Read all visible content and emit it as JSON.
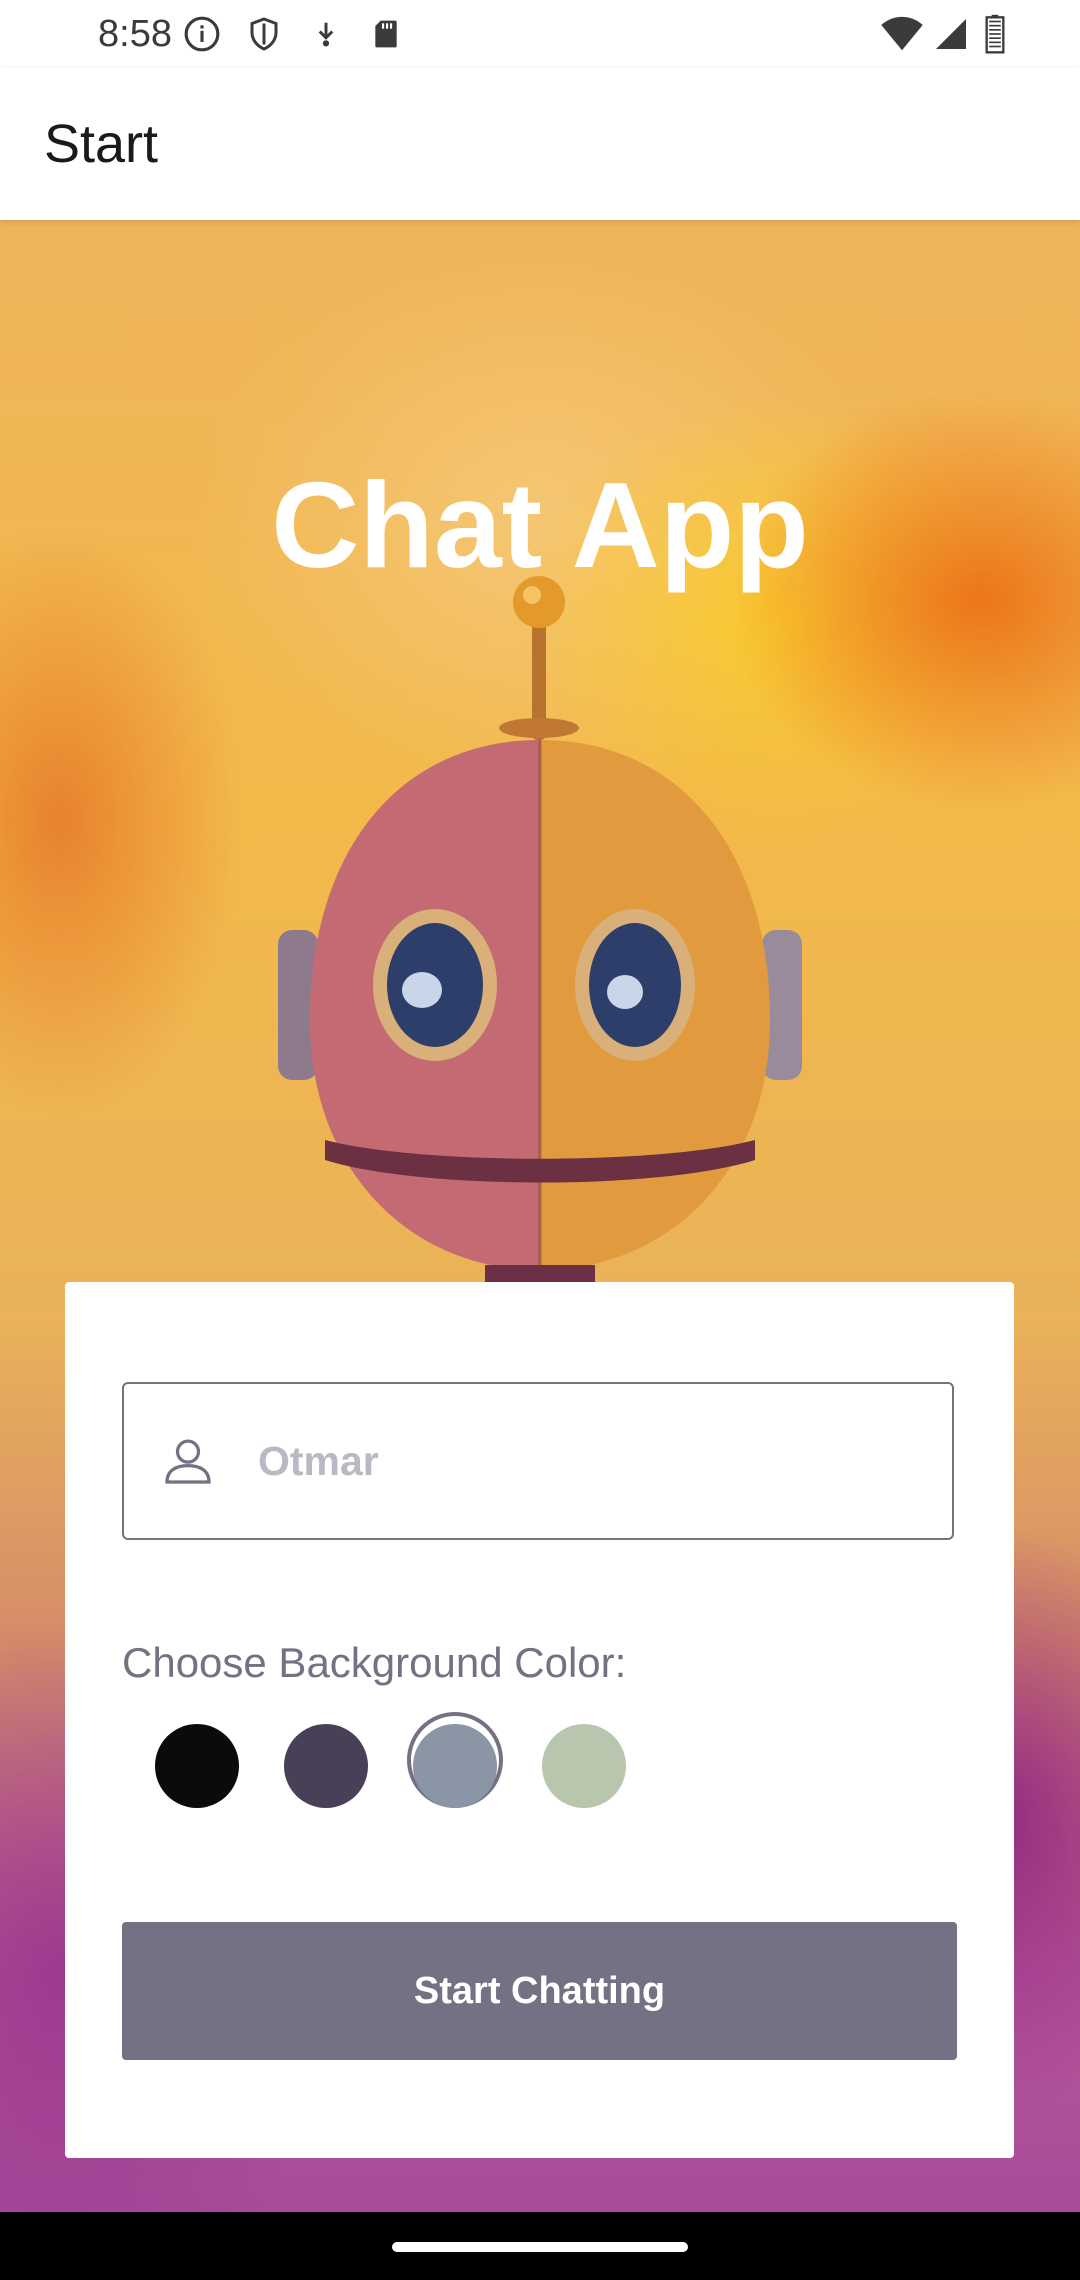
{
  "status_bar": {
    "time": "8:58",
    "icons_left": [
      "info-icon",
      "shield-icon",
      "download-icon",
      "sd-card-icon"
    ],
    "icons_right": [
      "wifi-icon",
      "cell-signal-icon",
      "battery-icon"
    ]
  },
  "app_bar": {
    "title": "Start"
  },
  "hero": {
    "title": "Chat App",
    "image": "watercolor-robot"
  },
  "form": {
    "name_input": {
      "value": "",
      "placeholder": "Otmar",
      "icon": "person-icon"
    },
    "color_label": "Choose Background Color:",
    "colors": [
      {
        "hex": "#090C08",
        "name": "black"
      },
      {
        "hex": "#474056",
        "name": "dark-purple"
      },
      {
        "hex": "#8A95A5",
        "name": "slate-blue",
        "selected": true
      },
      {
        "hex": "#B9C6AE",
        "name": "sage-green"
      }
    ],
    "start_button_label": "Start Chatting",
    "button_color": "#757083",
    "placeholder_color": "#B9B9C3"
  },
  "theme": {
    "label_color": "#757083",
    "card_color": "#FFFFFF"
  }
}
